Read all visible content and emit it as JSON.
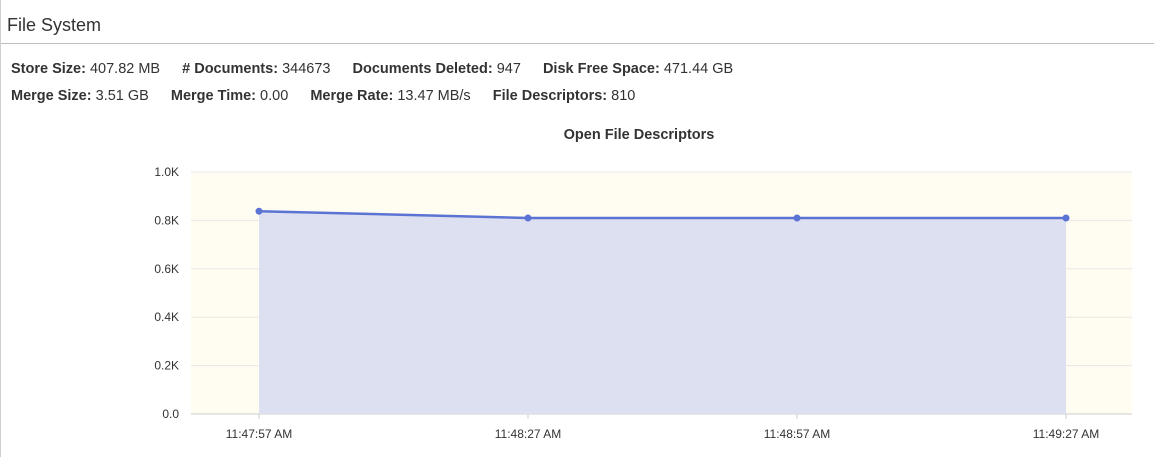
{
  "panel": {
    "title": "File System"
  },
  "stats": {
    "row1": [
      {
        "label": "Store Size:",
        "value": "407.82 MB"
      },
      {
        "label": "# Documents:",
        "value": "344673"
      },
      {
        "label": "Documents Deleted:",
        "value": "947"
      },
      {
        "label": "Disk Free Space:",
        "value": "471.44 GB"
      }
    ],
    "row2": [
      {
        "label": "Merge Size:",
        "value": "3.51 GB"
      },
      {
        "label": "Merge Time:",
        "value": "0.00"
      },
      {
        "label": "Merge Rate:",
        "value": "13.47 MB/s"
      },
      {
        "label": "File Descriptors:",
        "value": "810"
      }
    ]
  },
  "chart_data": {
    "type": "area",
    "title": "Open File Descriptors",
    "x": [
      "11:47:57 AM",
      "11:48:27 AM",
      "11:48:57 AM",
      "11:49:27 AM"
    ],
    "series": [
      {
        "values": [
          838,
          810,
          810,
          810
        ]
      }
    ],
    "yticks": [
      "0.0",
      "0.2K",
      "0.4K",
      "0.6K",
      "0.8K",
      "1.0K"
    ],
    "ylim": [
      0,
      1000
    ],
    "grid": true,
    "colors": {
      "line": "#5b74d4",
      "fill": "#dde0f0",
      "plot_background": "#fffcf2",
      "grid": "#e8e8e8"
    }
  }
}
